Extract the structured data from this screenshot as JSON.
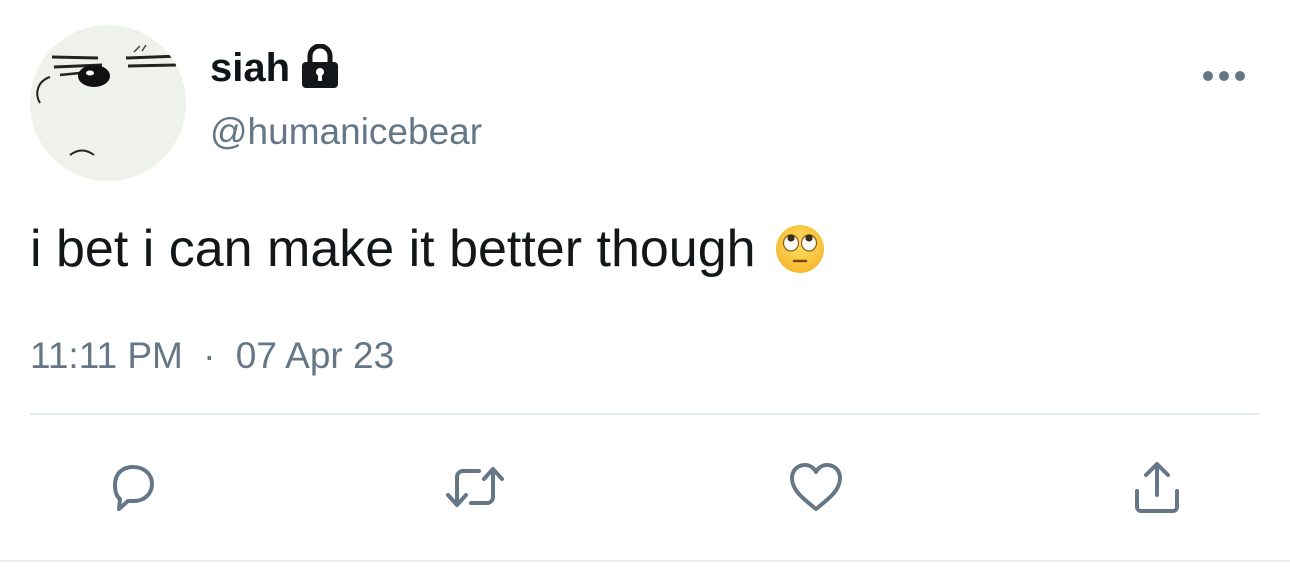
{
  "author": {
    "display_name": "siah",
    "handle": "@humanicebear",
    "protected": true,
    "avatar_icon": "bear-face-avatar"
  },
  "tweet": {
    "text": "i bet i can make it better though",
    "emoji": "face-with-rolling-eyes"
  },
  "meta": {
    "time": "11:11 PM",
    "separator": "·",
    "date": "07 Apr 23"
  },
  "actions": {
    "reply_icon": "speech-bubble-icon",
    "retweet_icon": "retweet-icon",
    "like_icon": "heart-icon",
    "share_icon": "share-icon"
  },
  "colors": {
    "text_primary": "#14171a",
    "text_secondary": "#657786",
    "icon": "#657786",
    "divider": "#e6ecf0"
  }
}
